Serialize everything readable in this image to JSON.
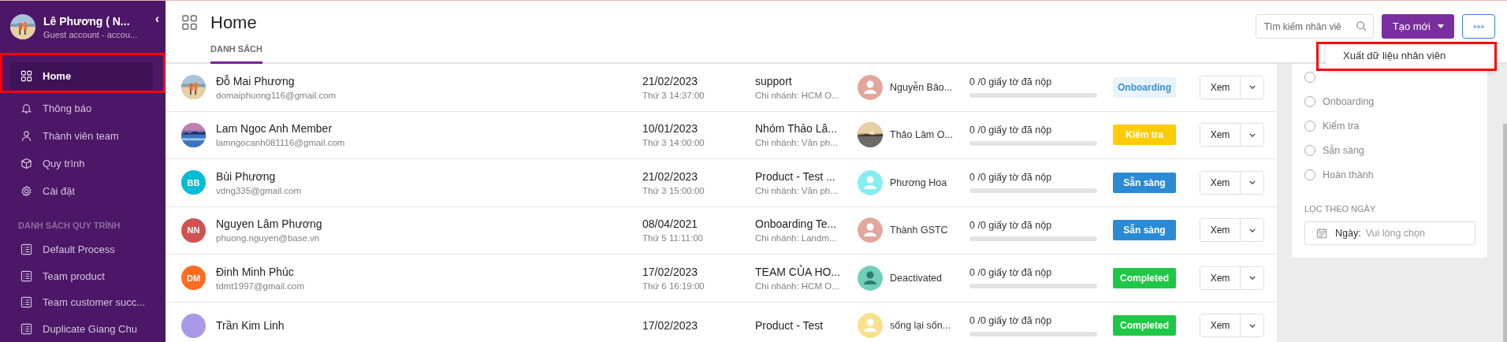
{
  "sidebar": {
    "user": {
      "name": "Lê Phương ( N...",
      "subtitle": "Guest account - accou..."
    },
    "collapse": "‹",
    "items": [
      {
        "label": "Home",
        "kind": "grid",
        "selected": true,
        "highlighted": true
      },
      {
        "label": "Thông báo",
        "kind": "bell",
        "selected": false,
        "highlighted": false
      },
      {
        "label": "Thành viên team",
        "kind": "user",
        "selected": false,
        "highlighted": false
      },
      {
        "label": "Quy trình",
        "kind": "cube",
        "selected": false,
        "highlighted": false
      },
      {
        "label": "Cài đặt",
        "kind": "gear",
        "selected": false,
        "highlighted": false
      }
    ],
    "section_title": "DANH SÁCH QUY TRÌNH",
    "processes": [
      {
        "label": "Default Process"
      },
      {
        "label": "Team product"
      },
      {
        "label": "Team customer succ..."
      },
      {
        "label": "Duplicate Giang Chu"
      }
    ]
  },
  "header": {
    "title": "Home",
    "tabs": [
      {
        "label": "DANH SÁCH",
        "selected": true
      }
    ],
    "search": {
      "placeholder": "Tìm kiếm nhân viê"
    },
    "create_button": "Tạo mới"
  },
  "menu": {
    "items": [
      {
        "label": "Xuất dữ liệu nhân viên",
        "highlighted": true
      }
    ]
  },
  "rows": [
    {
      "name": "Đỗ Mai Phương",
      "email": "domaiphuong116@gmail.com",
      "date": "21/02/2023",
      "time": "Thứ 3 14:37:00",
      "team": "support",
      "branch": "Chi nhánh: HCM O...",
      "manager": {
        "name": "Nguyễn Bảo...",
        "avatar": {
          "kind": "silhouette",
          "color": "#e3a69c"
        }
      },
      "docs": "0 /0 giấy tờ đã nộp",
      "progress": {
        "level": 0
      },
      "status": {
        "label": "Onboarding",
        "kind": "onboarding"
      },
      "action": "Xem"
    },
    {
      "name": "Lam Ngoc Anh Member",
      "email": "lamngocanh081116@gmail.com",
      "date": "10/01/2023",
      "time": "Thứ 3 14:00:00",
      "team": "Nhóm Thảo Lâ...",
      "branch": "Chi nhánh: Văn ph...",
      "manager": {
        "name": "Thảo Lâm O..."
      },
      "docs": "0 /0 giấy tờ đã nộp",
      "progress": {
        "level": 0
      },
      "status": {
        "label": "Kiểm tra",
        "kind": "check"
      },
      "action": "Xem"
    },
    {
      "name": "Bùi Phương",
      "email": "vdng335@gmail.com",
      "avatar": {
        "kind": "initials",
        "text": "BB",
        "color": "#00bcd4"
      },
      "date": "21/02/2023",
      "time": "Thứ 3 15:00:00",
      "team": "Product - Test ...",
      "branch": "Chi nhánh: Văn ph...",
      "manager": {
        "name": "Phương Hoa",
        "avatar": {
          "kind": "silhouette",
          "color": "#84eef0"
        }
      },
      "docs": "0 /0 giấy tờ đã nộp",
      "progress": {
        "level": 0
      },
      "status": {
        "label": "Sẵn sàng",
        "kind": "ready"
      },
      "action": "Xem"
    },
    {
      "name": "Nguyen Lâm Phương",
      "email": "phuong.nguyen@base.vn",
      "avatar": {
        "kind": "initials",
        "text": "NN",
        "color": "#d05252"
      },
      "date": "08/04/2021",
      "time": "Thứ 5 11:11:00",
      "team": "Onboarding Te...",
      "branch": "Chi nhánh: Landm...",
      "manager": {
        "name": "Thành GSTC",
        "avatar": {
          "kind": "silhouette",
          "color": "#e3a69c"
        }
      },
      "docs": "0 /0 giấy tờ đã nộp",
      "progress": {
        "level": 0
      },
      "status": {
        "label": "Sẵn sàng",
        "kind": "ready"
      },
      "action": "Xem"
    },
    {
      "name": "Đinh Minh Phúc",
      "email": "tdmt1997@gmail.com",
      "avatar": {
        "kind": "initials",
        "text": "DM",
        "color": "#ff6d22"
      },
      "date": "17/02/2023",
      "time": "Thứ 6 16:19:00",
      "team": "TEAM CỦA HO...",
      "branch": "Chi nhánh: HCM O...",
      "manager": {
        "name": "Deactivated",
        "avatar": {
          "kind": "deactivated",
          "color": "#6fcfba"
        }
      },
      "docs": "0 /0 giấy tờ đã nộp",
      "progress": {
        "level": 0
      },
      "status": {
        "label": "Completed",
        "kind": "completed"
      },
      "action": "Xem"
    },
    {
      "name": "Trần Kim Linh",
      "avatar": {
        "kind": "initials",
        "color": "#a99ae8"
      },
      "date": "17/02/2023",
      "team": "Product - Test",
      "manager": {
        "name": "sống lại sốn...",
        "avatar": {
          "kind": "silhouette",
          "color": "#f8e08e"
        }
      },
      "docs": "0 /0 giấy tờ đã nộp",
      "progress": {
        "level": 0
      },
      "status": {
        "label": "Completed",
        "kind": "completed"
      },
      "action": "Xem"
    }
  ],
  "filter": {
    "options": [
      {
        "selected": false
      },
      {
        "label": "Onboarding",
        "selected": false
      },
      {
        "label": "Kiểm tra",
        "selected": false
      },
      {
        "label": "Sẵn sàng",
        "selected": false
      },
      {
        "label": "Hoàn thành",
        "selected": false
      }
    ],
    "date_title": "LỌC THEO NGÀY",
    "date_field": {
      "label": "Ngày:",
      "placeholder": "Vui lòng chọn"
    }
  }
}
